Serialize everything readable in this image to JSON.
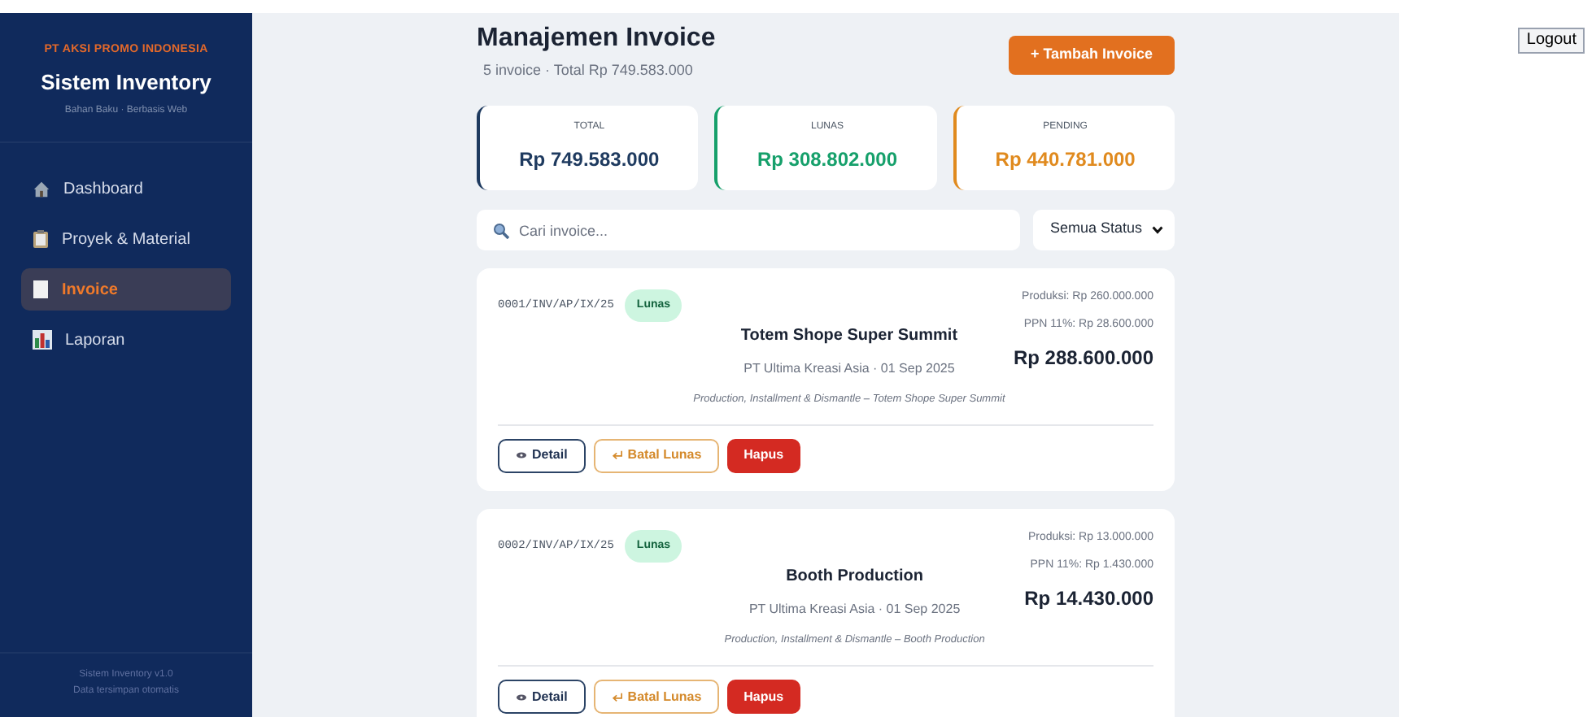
{
  "sidebar": {
    "company": "PT AKSI PROMO INDONESIA",
    "app_title": "Sistem Inventory",
    "subtitle": "Bahan Baku · Berbasis Web",
    "nav": [
      {
        "label": "Dashboard",
        "selected": false
      },
      {
        "label": "Proyek & Material",
        "selected": false
      },
      {
        "label": "Invoice",
        "selected": true
      },
      {
        "label": "Laporan",
        "selected": false
      }
    ],
    "footer": [
      "Sistem Inventory v1.0",
      "Data tersimpan otomatis"
    ]
  },
  "header": {
    "title": "Manajemen Invoice",
    "subtitle": "5 invoice · Total Rp 749.583.000",
    "add_button": "+ Tambah Invoice"
  },
  "stats": [
    {
      "label": "TOTAL",
      "value": "Rp 749.583.000",
      "color": "#1e3a5f"
    },
    {
      "label": "LUNAS",
      "value": "Rp 308.802.000",
      "color": "#16a06b"
    },
    {
      "label": "PENDING",
      "value": "Rp 440.781.000",
      "color": "#e08a1e"
    }
  ],
  "search": {
    "placeholder": "Cari invoice..."
  },
  "status_filter": {
    "value": "Semua Status"
  },
  "invoices": [
    {
      "number": "0001/INV/AP/IX/25",
      "status": "Lunas",
      "title": "Totem Shope Super Summit",
      "client_date": "PT Ultima Kreasi Asia · 01 Sep 2025",
      "description": "Production, Installment & Dismantle – Totem Shope Super Summit",
      "production": "Produksi: Rp 260.000.000",
      "ppn": "PPN 11%: Rp 28.600.000",
      "total": "Rp 288.600.000",
      "buttons": [
        {
          "kind": "detail",
          "label": "Detail"
        },
        {
          "kind": "unpay",
          "label": "Batal Lunas"
        },
        {
          "kind": "delete",
          "label": "Hapus"
        }
      ]
    },
    {
      "number": "0002/INV/AP/IX/25",
      "status": "Lunas",
      "title": "Booth Production",
      "client_date": "PT Ultima Kreasi Asia · 01 Sep 2025",
      "description": "Production, Installment & Dismantle – Booth Production",
      "production": "Produksi: Rp 13.000.000",
      "ppn": "PPN 11%: Rp 1.430.000",
      "total": "Rp 14.430.000",
      "buttons": [
        {
          "kind": "detail",
          "label": "Detail"
        },
        {
          "kind": "unpay",
          "label": "Batal Lunas"
        },
        {
          "kind": "delete",
          "label": "Hapus"
        }
      ]
    }
  ],
  "logout": "Logout"
}
